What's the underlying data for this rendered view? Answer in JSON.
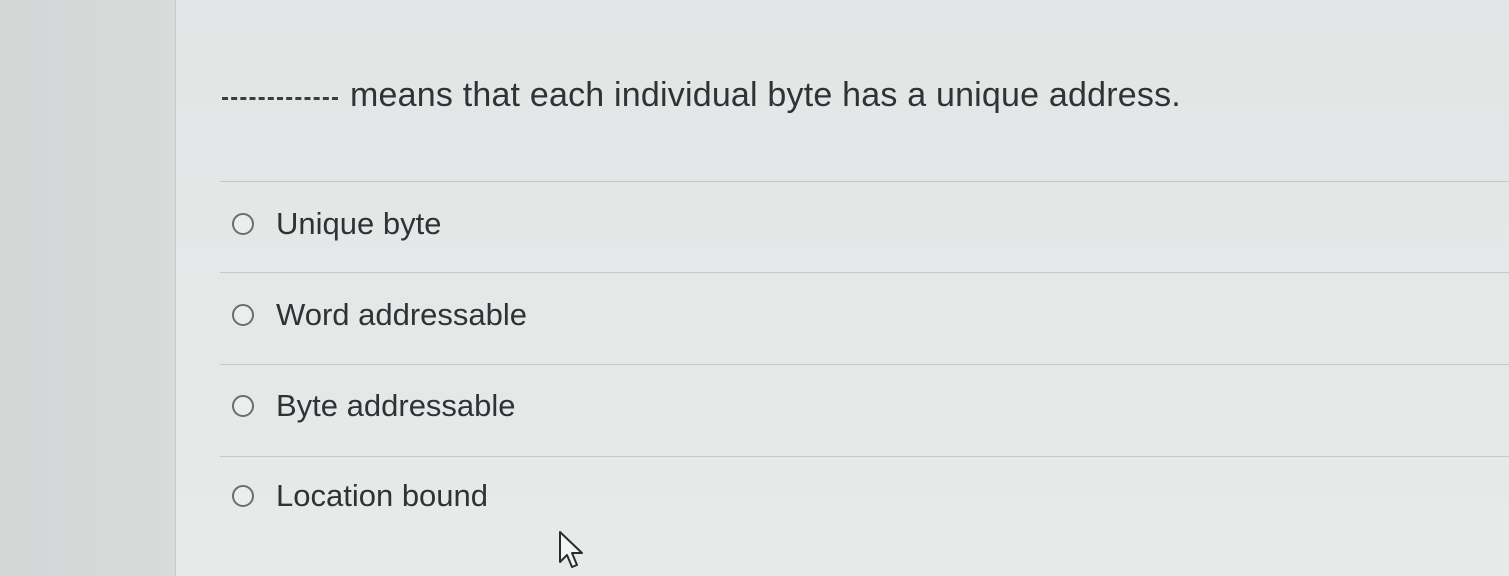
{
  "question": {
    "blank_placeholder": "",
    "text": "means that each individual byte has a unique address."
  },
  "options": [
    {
      "label": "Unique byte",
      "selected": false
    },
    {
      "label": "Word addressable",
      "selected": false
    },
    {
      "label": "Byte addressable",
      "selected": false
    },
    {
      "label": "Location bound",
      "selected": false
    }
  ],
  "icons": {
    "cursor": "mouse-pointer-icon",
    "radio": "radio-button-icon"
  }
}
